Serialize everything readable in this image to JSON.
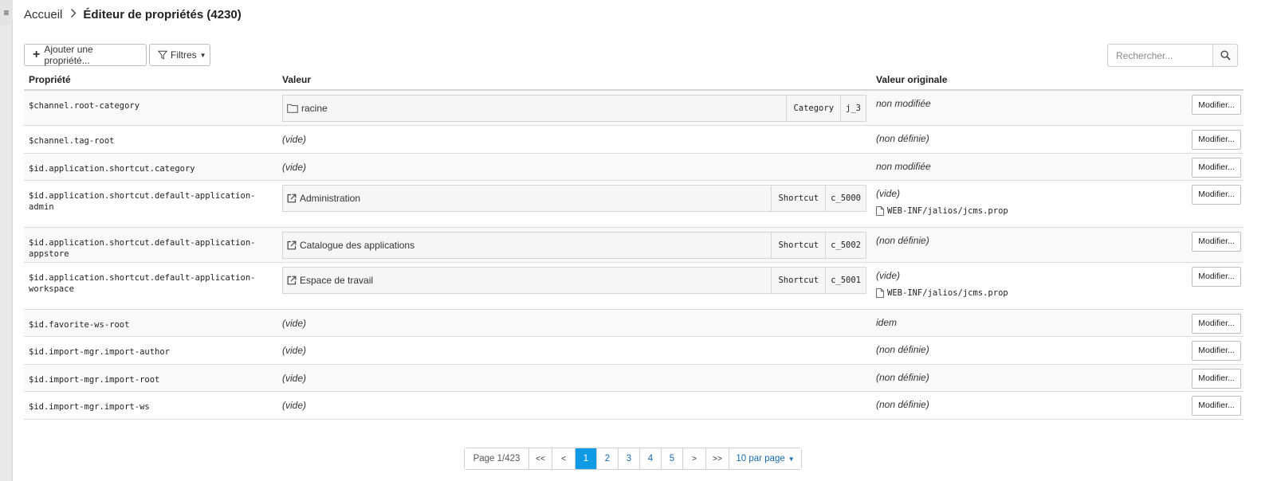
{
  "breadcrumb": {
    "home": "Accueil",
    "current": "Éditeur de propriétés (4230)"
  },
  "toolbar": {
    "add_label": "Ajouter une propriété...",
    "filter_label": "Filtres",
    "search_placeholder": "Rechercher..."
  },
  "table": {
    "headers": {
      "property": "Propriété",
      "value": "Valeur",
      "original": "Valeur originale"
    },
    "rows": [
      {
        "name": "$channel.root-category",
        "value": {
          "kind": "ref",
          "icon": "folder-icon",
          "label": "racine",
          "type": "Category",
          "id": "j_3"
        },
        "original": "non modifiée",
        "file": null,
        "action": "Modifier..."
      },
      {
        "name": "$channel.tag-root",
        "value": {
          "kind": "text",
          "text": "(vide)"
        },
        "original": "(non définie)",
        "file": null,
        "action": "Modifier..."
      },
      {
        "name": "$id.application.shortcut.category",
        "value": {
          "kind": "text",
          "text": "(vide)"
        },
        "original": "non modifiée",
        "file": null,
        "action": "Modifier..."
      },
      {
        "name": "$id.application.shortcut.default-application-admin",
        "value": {
          "kind": "ref",
          "icon": "external-link-icon",
          "label": "Administration",
          "type": "Shortcut",
          "id": "c_5000"
        },
        "original": "(vide)",
        "file": "WEB-INF/jalios/jcms.prop",
        "action": "Modifier..."
      },
      {
        "name": "$id.application.shortcut.default-application-appstore",
        "value": {
          "kind": "ref",
          "icon": "external-link-icon",
          "label": "Catalogue des applications",
          "type": "Shortcut",
          "id": "c_5002"
        },
        "original": "(non définie)",
        "file": null,
        "action": "Modifier..."
      },
      {
        "name": "$id.application.shortcut.default-application-workspace",
        "value": {
          "kind": "ref",
          "icon": "external-link-icon",
          "label": "Espace de travail",
          "type": "Shortcut",
          "id": "c_5001"
        },
        "original": "(vide)",
        "file": "WEB-INF/jalios/jcms.prop",
        "action": "Modifier..."
      },
      {
        "name": "$id.favorite-ws-root",
        "value": {
          "kind": "text",
          "text": "(vide)"
        },
        "original": "idem",
        "file": null,
        "action": "Modifier..."
      },
      {
        "name": "$id.import-mgr.import-author",
        "value": {
          "kind": "text",
          "text": "(vide)"
        },
        "original": "(non définie)",
        "file": null,
        "action": "Modifier..."
      },
      {
        "name": "$id.import-mgr.import-root",
        "value": {
          "kind": "text",
          "text": "(vide)"
        },
        "original": "(non définie)",
        "file": null,
        "action": "Modifier..."
      },
      {
        "name": "$id.import-mgr.import-ws",
        "value": {
          "kind": "text",
          "text": "(vide)"
        },
        "original": "(non définie)",
        "file": null,
        "action": "Modifier..."
      }
    ]
  },
  "pagination": {
    "info": "Page 1/423",
    "first": "<<",
    "prev": "<",
    "pages": [
      "1",
      "2",
      "3",
      "4",
      "5"
    ],
    "active_page": "1",
    "next": ">",
    "last": ">>",
    "page_size": "10 par page"
  }
}
